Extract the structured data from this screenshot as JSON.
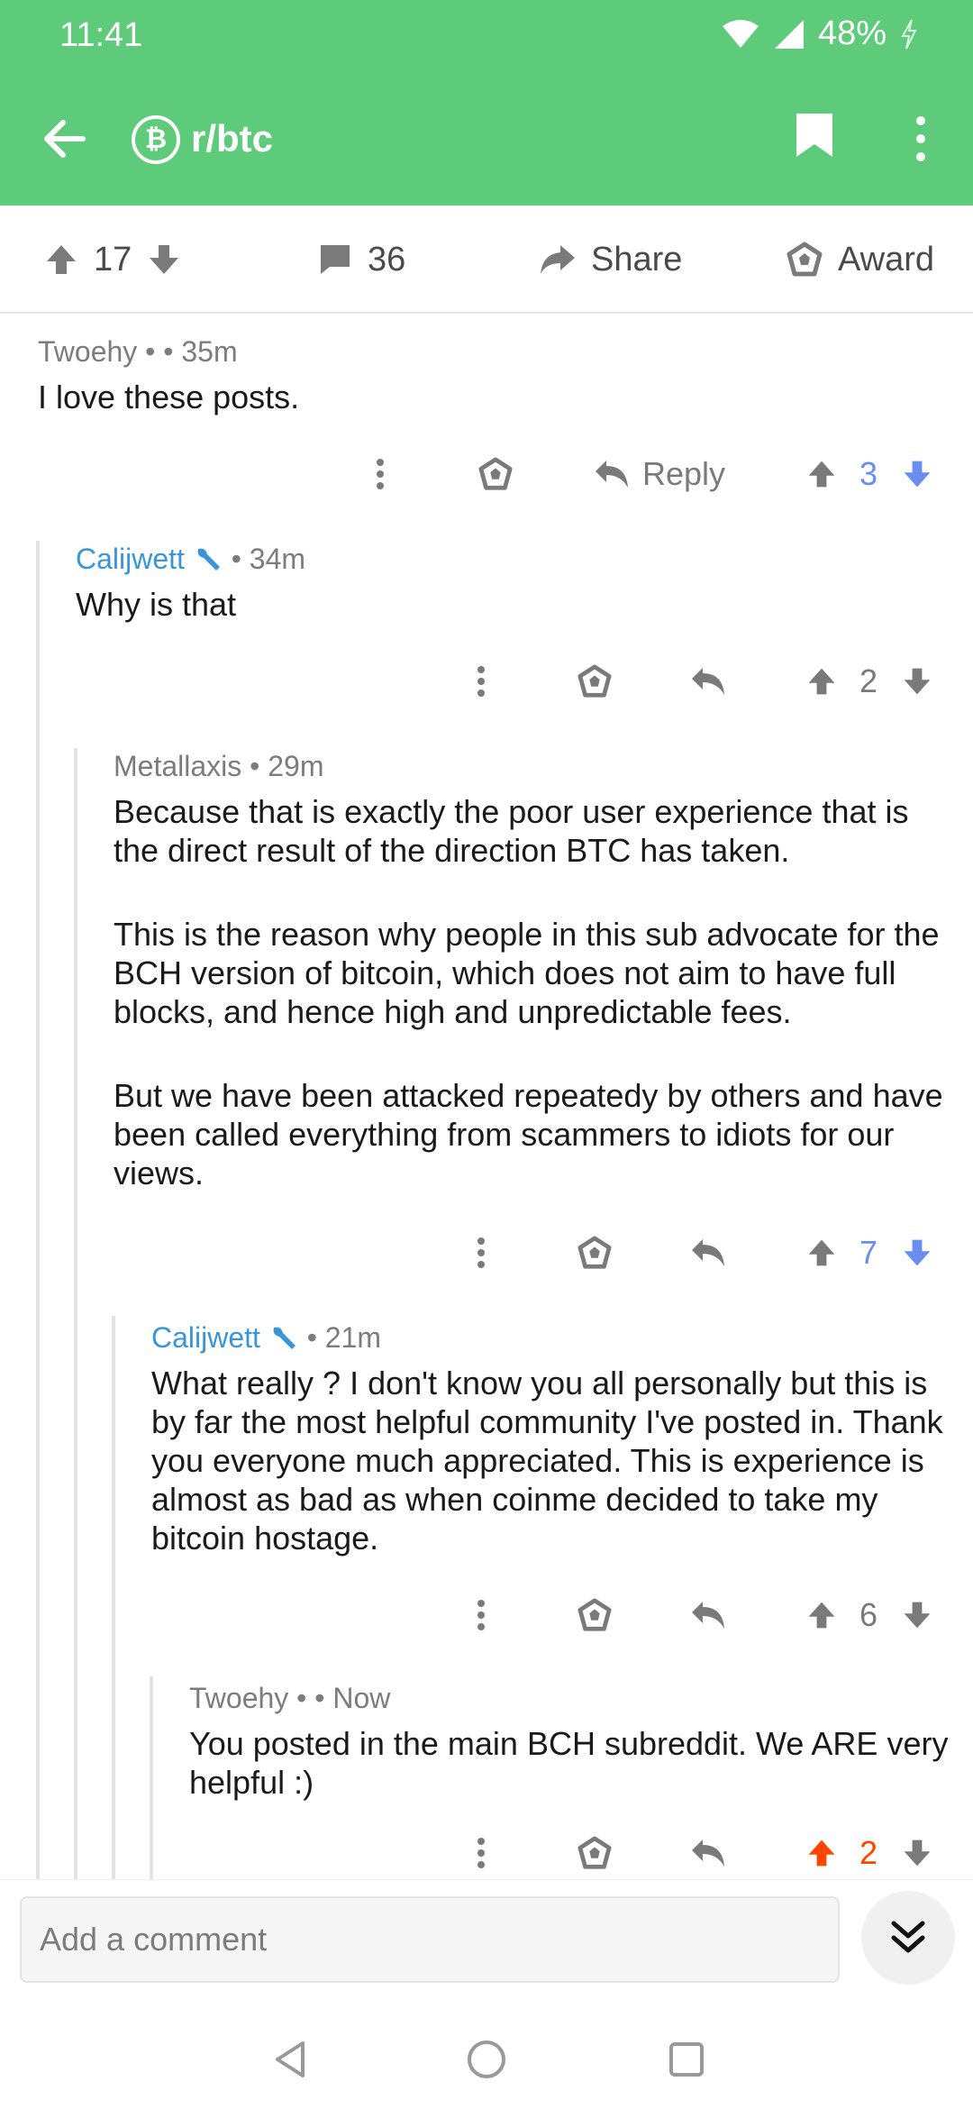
{
  "status_bar": {
    "time": "11:41",
    "battery": "48%"
  },
  "toolbar": {
    "subreddit": "r/btc",
    "sub_icon_glyph": "₿"
  },
  "post_actions": {
    "score": "17",
    "comments": "36",
    "share_label": "Share",
    "award_label": "Award"
  },
  "comments": [
    {
      "author": "Twoehy",
      "separator": "• •",
      "time": "35m",
      "paragraphs": [
        "I love these posts."
      ],
      "reply_label": "Reply",
      "score": "3",
      "vote_state": "down"
    },
    {
      "author": "Calijwett",
      "separator": "•",
      "time": "34m",
      "paragraphs": [
        "Why is that"
      ],
      "score": "2",
      "vote_state": "none"
    },
    {
      "author": "Metallaxis",
      "separator": "•",
      "time": "29m",
      "paragraphs": [
        "Because that is exactly the poor user experience that is the direct result of the direction BTC has taken.",
        "This is the reason why people in this sub advocate for the BCH version of bitcoin, which does not aim to have full blocks, and hence high and unpredictable fees.",
        "But we have been attacked repeatedy by others and have been called everything from scammers to idiots for our views."
      ],
      "score": "7",
      "vote_state": "down"
    },
    {
      "author": "Calijwett",
      "separator": "•",
      "time": "21m",
      "paragraphs": [
        "What really ? I don't know you all personally but this is by far the most helpful community I've posted in. Thank you everyone much appreciated. This is experience is almost as bad as when coinme decided to take my bitcoin hostage."
      ],
      "score": "6",
      "vote_state": "none"
    },
    {
      "author": "Twoehy",
      "separator": "• •",
      "time": "Now",
      "paragraphs": [
        "You posted in the main BCH subreddit. We ARE very helpful :)"
      ],
      "score": "2",
      "vote_state": "up"
    }
  ],
  "comment_bar": {
    "placeholder": "Add a comment"
  },
  "colors": {
    "header": "#5ecb7a",
    "author_blue": "#3a95d8",
    "upvote": "#ff4500",
    "downvote": "#6a8df0"
  }
}
